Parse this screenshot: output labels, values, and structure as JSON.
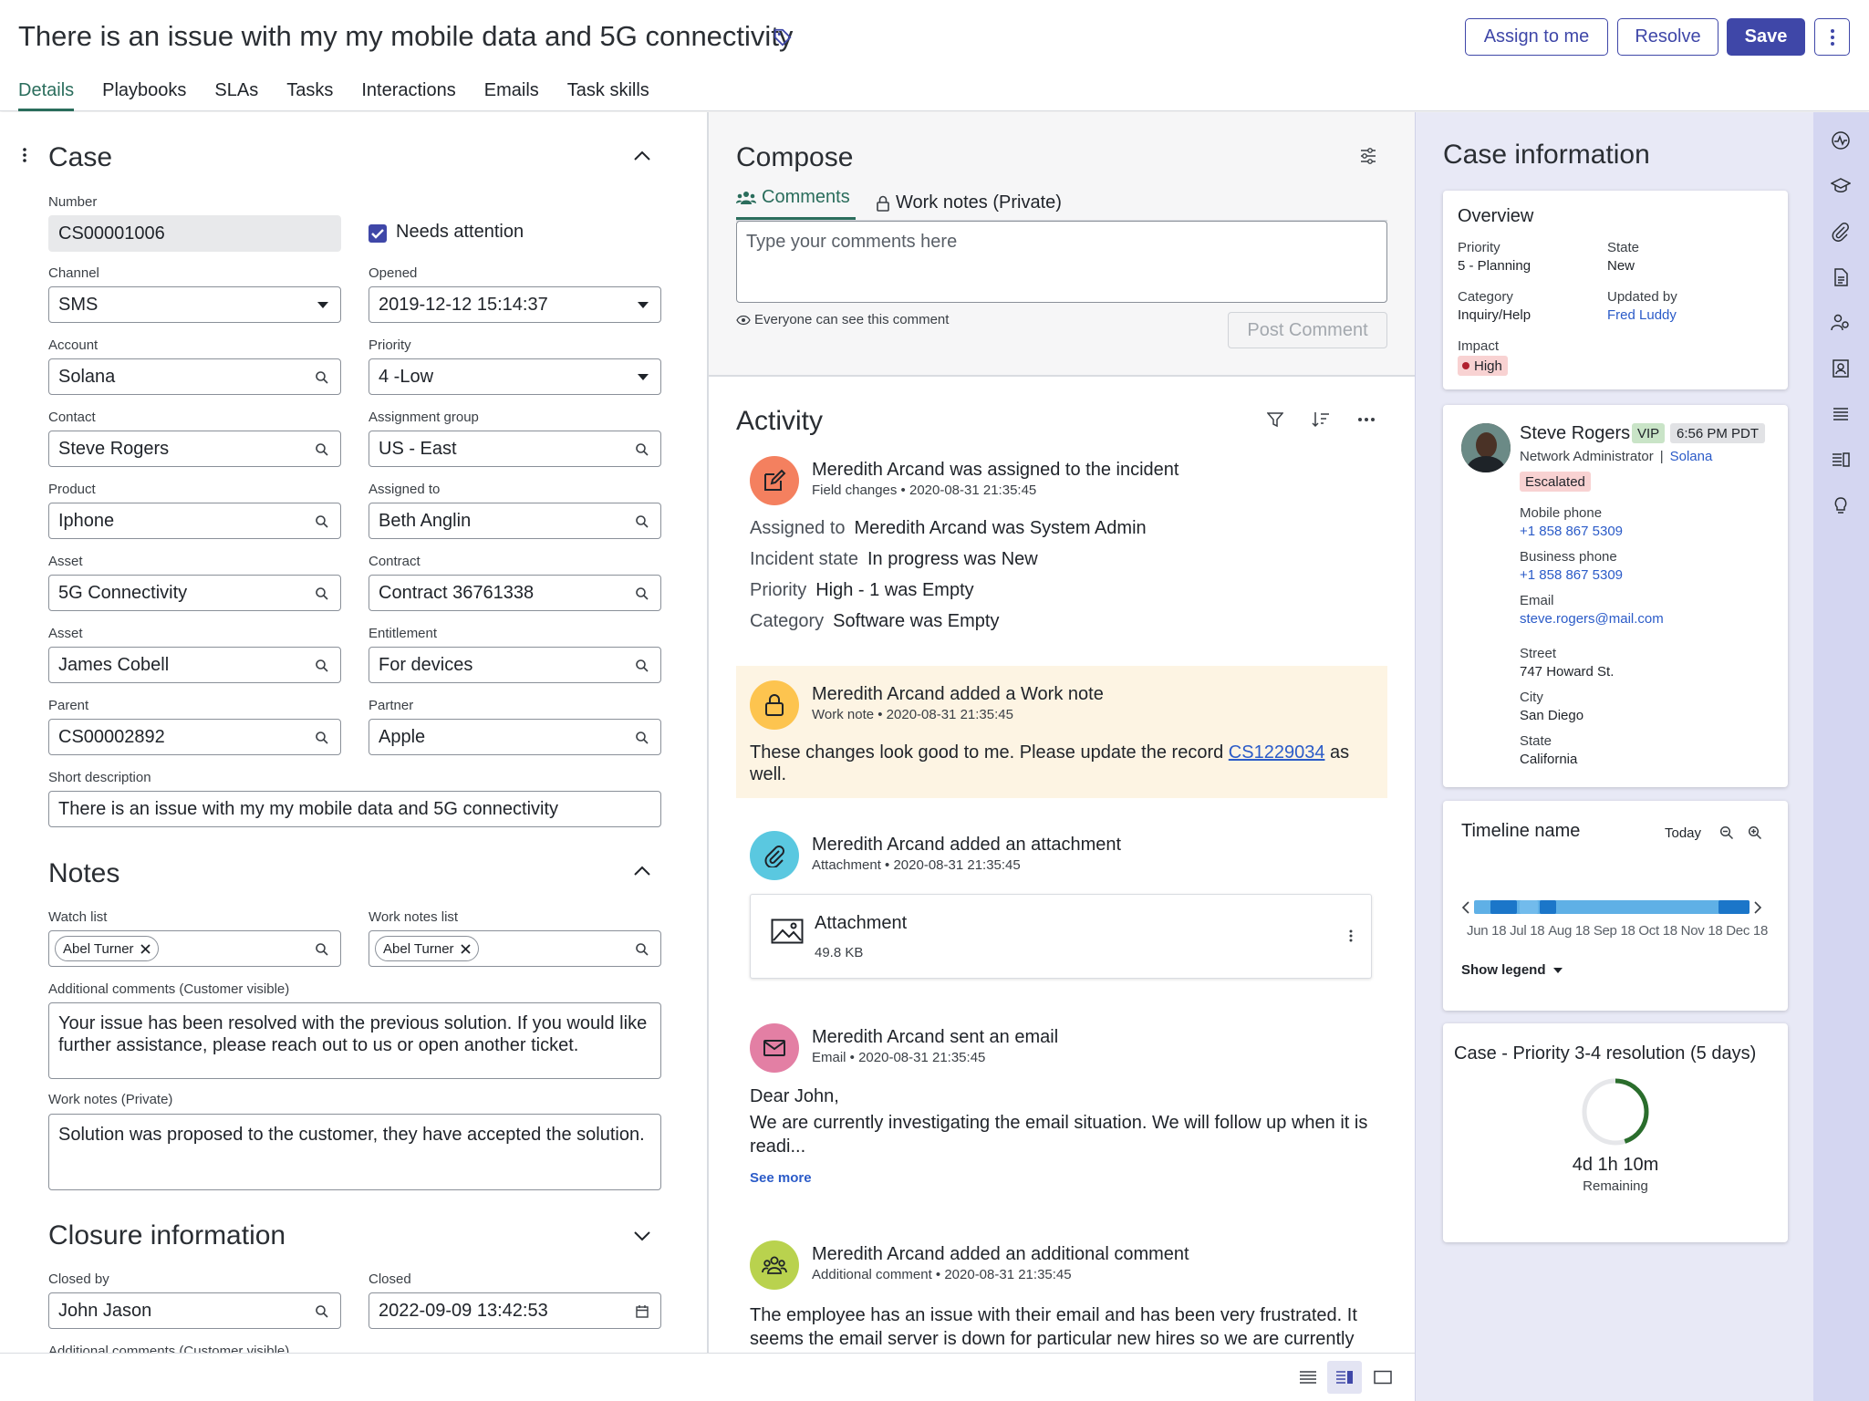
{
  "header": {
    "title": "There is an issue with my my mobile data and 5G connectivity",
    "buttons": {
      "assign": "Assign to me",
      "resolve": "Resolve",
      "save": "Save"
    },
    "tabs": [
      "Details",
      "Playbooks",
      "SLAs",
      "Tasks",
      "Interactions",
      "Emails",
      "Task skills"
    ],
    "active_tab": "Details"
  },
  "case": {
    "title": "Case",
    "number_label": "Number",
    "number": "CS00001006",
    "needs_attention": "Needs attention",
    "channel_label": "Channel",
    "channel": "SMS",
    "opened_label": "Opened",
    "opened": "2019-12-12 15:14:37",
    "account_label": "Account",
    "account": "Solana",
    "priority_label": "Priority",
    "priority": "4 -Low",
    "contact_label": "Contact",
    "contact": "Steve Rogers",
    "assignment_group_label": "Assignment group",
    "assignment_group": "US - East",
    "product_label": "Product",
    "product": "Iphone",
    "assigned_to_label": "Assigned to",
    "assigned_to": "Beth Anglin",
    "asset_label": "Asset",
    "asset": "5G Connectivity",
    "contract_label": "Contract",
    "contract": "Contract 36761338",
    "asset2_label": "Asset",
    "asset2": "James Cobell",
    "entitlement_label": "Entitlement",
    "entitlement": "For devices",
    "parent_label": "Parent",
    "parent": "CS00002892",
    "partner_label": "Partner",
    "partner": "Apple",
    "short_desc_label": "Short description",
    "short_desc": "There is an issue with my my mobile data and 5G connectivity"
  },
  "notes": {
    "title": "Notes",
    "watch_list_label": "Watch list",
    "watch_list_pill": "Abel Turner",
    "work_notes_list_label": "Work notes list",
    "work_notes_list_pill": "Abel Turner",
    "additional_comments_label": "Additional comments (Customer visible)",
    "additional_comments": "Your issue has been resolved with the previous solution. If you would like further assistance, please reach out to us or open another ticket.",
    "work_notes_label": "Work notes (Private)",
    "work_notes": "Solution was proposed to the customer, they have accepted the solution."
  },
  "closure": {
    "title": "Closure information",
    "closed_by_label": "Closed by",
    "closed_by": "John Jason",
    "closed_label": "Closed",
    "closed": "2022-09-09 13:42:53",
    "cut_label": "Additional comments (Customer visible)"
  },
  "compose": {
    "title": "Compose",
    "tab_comments": "Comments",
    "tab_work_notes": "Work notes (Private)",
    "placeholder": "Type your comments here",
    "visibility": "Everyone can see this comment",
    "post": "Post Comment"
  },
  "activity": {
    "title": "Activity",
    "items": [
      {
        "heading": "Meredith Arcand was assigned to the incident",
        "sub": "Field changes  •  2020-08-31 21:35:45",
        "rows": [
          {
            "k": "Assigned to",
            "v": "Meredith Arcand was System Admin"
          },
          {
            "k": "Incident state",
            "v": "In progress was New"
          },
          {
            "k": "Priority",
            "v": "High - 1 was Empty"
          },
          {
            "k": "Category",
            "v": "Software was Empty"
          }
        ]
      },
      {
        "heading": "Meredith Arcand added a Work note",
        "sub": "Work note  •  2020-08-31 21:35:45",
        "body_pre": "These changes look good to me. Please update the record ",
        "body_link": "CS1229034",
        "body_post": " as well."
      },
      {
        "heading": "Meredith Arcand added an attachment",
        "sub": "Attachment  •  2020-08-31 21:35:45",
        "attachment_name": "Attachment",
        "attachment_size": "49.8 KB"
      },
      {
        "heading": "Meredith Arcand sent an email",
        "sub": "Email  •  2020-08-31 21:35:45",
        "body_l1": "Dear John,",
        "body_l2": "We are currently investigating the email situation. We will follow up when it is readi...",
        "see_more": "See more"
      },
      {
        "heading": "Meredith Arcand added an additional comment",
        "sub": "Additional comment  •  2020-08-31 21:35:45",
        "body": "The employee has an issue with their email and has been very frustrated. It seems the email server is down for particular new hires so we are currently"
      }
    ]
  },
  "case_info": {
    "title": "Case information",
    "overview": {
      "title": "Overview",
      "priority_label": "Priority",
      "priority": "5 - Planning",
      "state_label": "State",
      "state": "New",
      "category_label": "Category",
      "category": "Inquiry/Help",
      "updated_by_label": "Updated by",
      "updated_by": "Fred Luddy",
      "impact_label": "Impact",
      "impact": "High"
    },
    "contact": {
      "name": "Steve Rogers",
      "vip": "VIP",
      "time": "6:56 PM PDT",
      "role": "Network Administrator",
      "company": "Solana",
      "escalated": "Escalated",
      "mobile_label": "Mobile phone",
      "mobile": "+1 858 867 5309",
      "business_label": "Business phone",
      "business": "+1 858 867 5309",
      "email_label": "Email",
      "email": "steve.rogers@mail.com",
      "street_label": "Street",
      "street": "747 Howard St.",
      "city_label": "City",
      "city": "San Diego",
      "state_label": "State",
      "state": "California"
    },
    "timeline": {
      "title": "Timeline name",
      "today": "Today",
      "months": [
        "Jun 18",
        "Jul 18",
        "Aug 18",
        "Sep 18",
        "Oct 18",
        "Nov 18",
        "Dec 18"
      ],
      "show_legend": "Show legend"
    },
    "sla": {
      "title": "Case - Priority 3-4 resolution (5 days)",
      "remaining_value": "4d 1h 10m",
      "remaining_label": "Remaining",
      "progress_fraction": 0.45
    }
  },
  "colors": {
    "brand": "#3f47a8",
    "accent": "#2a6d5c",
    "link": "#2b5bc8",
    "impact_high": "#f5c6c6"
  }
}
